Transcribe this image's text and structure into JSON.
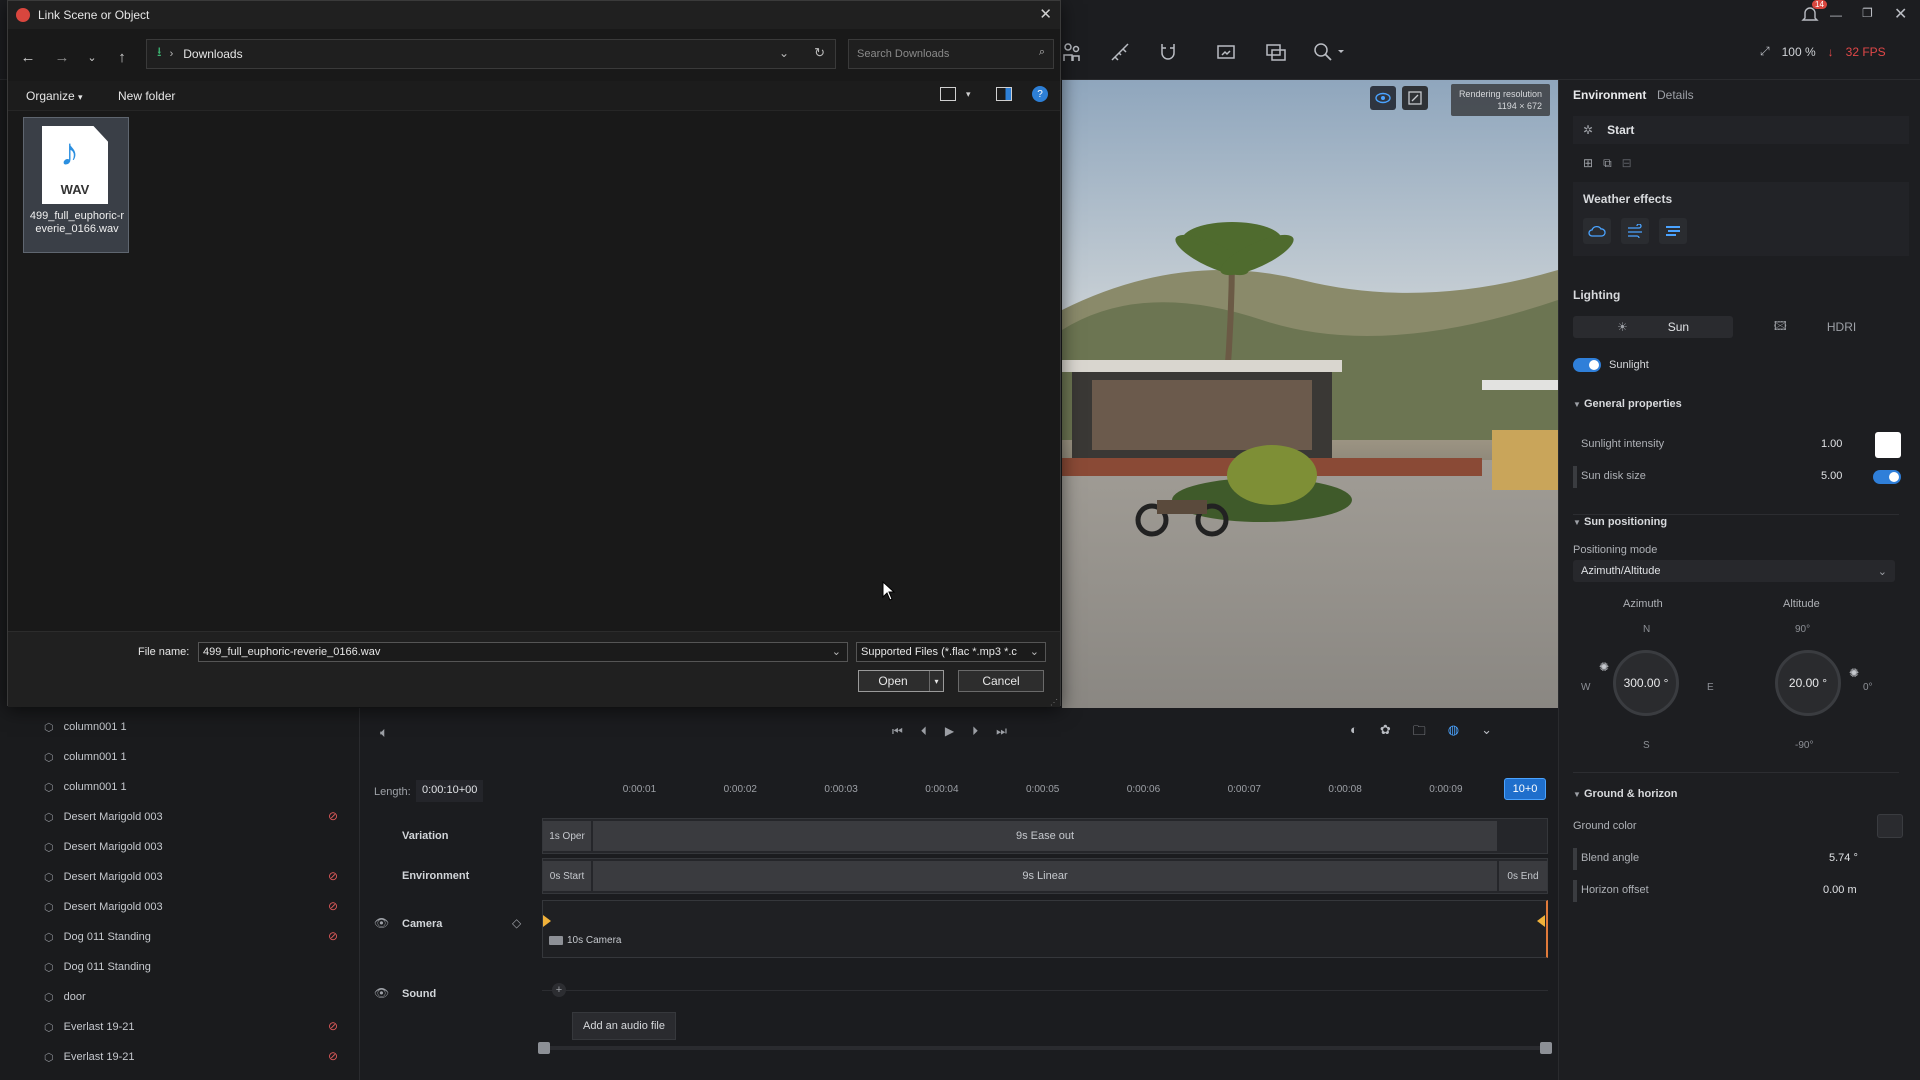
{
  "dialog": {
    "title": "Link Scene or Object",
    "breadcrumb": "Downloads",
    "search_placeholder": "Search Downloads",
    "organize_label": "Organize",
    "new_folder_label": "New folder",
    "file": {
      "badge": "WAV",
      "name": "499_full_euphoric-reverie_0166.wav"
    },
    "file_name_label": "File name:",
    "file_name_value": "499_full_euphoric-reverie_0166.wav",
    "file_type_value": "Supported Files (*.flac *.mp3 *.c",
    "open_label": "Open",
    "cancel_label": "Cancel"
  },
  "topbar": {
    "notification_count": "14",
    "zoom": "100 %",
    "fps": "32 FPS",
    "fps_color": "#e04848"
  },
  "viewport": {
    "res_label": "Rendering resolution",
    "res_value": "1194 × 672"
  },
  "right_panel": {
    "tabs": [
      "Environment",
      "Details"
    ],
    "start_label": "Start",
    "weather_label": "Weather effects",
    "lighting_label": "Lighting",
    "lighting_modes": [
      "Sun",
      "HDRI"
    ],
    "sunlight_label": "Sunlight",
    "general_label": "General properties",
    "sunlight_intensity_label": "Sunlight intensity",
    "sunlight_intensity_value": "1.00",
    "sun_disk_label": "Sun disk size",
    "sun_disk_value": "5.00",
    "sun_pos_label": "Sun positioning",
    "positioning_mode_label": "Positioning mode",
    "positioning_mode_value": "Azimuth/Altitude",
    "azimuth_label": "Azimuth",
    "altitude_label": "Altitude",
    "azimuth_value": "300.00 °",
    "altitude_value": "20.00 °",
    "compass": {
      "n": "N",
      "s": "S",
      "e": "E",
      "w": "W"
    },
    "alt_marks": {
      "top": "90°",
      "right": "0°",
      "bottom": "-90°"
    },
    "ground_label": "Ground & horizon",
    "ground_color_label": "Ground color",
    "blend_angle_label": "Blend angle",
    "blend_angle_value": "5.74 °",
    "horizon_offset_label": "Horizon offset",
    "horizon_offset_value": "0.00 m",
    "accent": "#2f7fd9"
  },
  "object_list": [
    {
      "name": "column001 1",
      "hidden": false
    },
    {
      "name": "column001 1",
      "hidden": false
    },
    {
      "name": "column001 1",
      "hidden": false
    },
    {
      "name": "Desert Marigold 003",
      "hidden": true
    },
    {
      "name": "Desert Marigold 003",
      "hidden": false
    },
    {
      "name": "Desert Marigold 003",
      "hidden": true
    },
    {
      "name": "Desert Marigold 003",
      "hidden": true
    },
    {
      "name": "Dog 011 Standing",
      "hidden": true
    },
    {
      "name": "Dog 011 Standing",
      "hidden": false
    },
    {
      "name": "door",
      "hidden": false
    },
    {
      "name": "Everlast 19-21",
      "hidden": true
    },
    {
      "name": "Everlast 19-21",
      "hidden": true
    }
  ],
  "timeline": {
    "length_label": "Length:",
    "length_value": "0:00:10+00",
    "ticks": [
      "0:00:01",
      "0:00:02",
      "0:00:03",
      "0:00:04",
      "0:00:05",
      "0:00:06",
      "0:00:07",
      "0:00:08",
      "0:00:09"
    ],
    "end_marker": "10+0",
    "rows": {
      "variation": "Variation",
      "environment": "Environment",
      "camera": "Camera",
      "sound": "Sound"
    },
    "variation_clips": [
      "1s Oper",
      "9s Ease out"
    ],
    "environment_clips": [
      "0s Start",
      "9s Linear",
      "0s End"
    ],
    "camera_clip": "10s Camera",
    "add_audio": "Add an audio file"
  }
}
